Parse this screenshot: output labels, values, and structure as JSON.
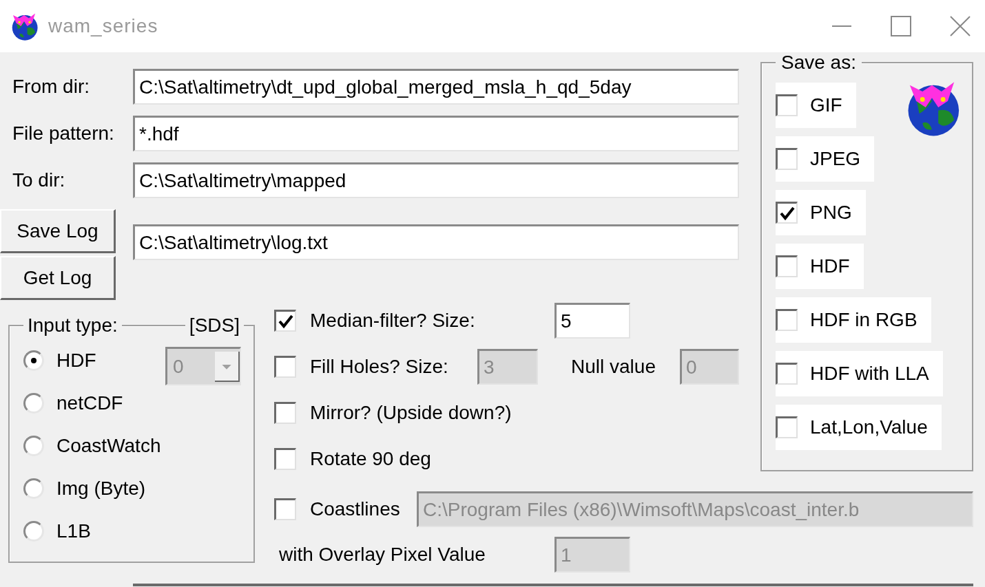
{
  "window": {
    "title": "wam_series"
  },
  "paths": [
    {
      "label": "From dir:",
      "value": "C:\\Sat\\altimetry\\dt_upd_global_merged_msla_h_qd_5day"
    },
    {
      "label": "File pattern:",
      "value": "*.hdf"
    },
    {
      "label": "To dir:",
      "value": "C:\\Sat\\altimetry\\mapped"
    }
  ],
  "log": {
    "buttons": [
      "Save Log",
      "Get Log"
    ],
    "value": "C:\\Sat\\altimetry\\log.txt"
  },
  "input_type": {
    "legend": "Input type:",
    "sds_label": "[SDS]",
    "sds_value": "0",
    "sds_disabled": true,
    "options": [
      {
        "label": "HDF",
        "selected": true
      },
      {
        "label": "netCDF",
        "selected": false
      },
      {
        "label": "CoastWatch",
        "selected": false
      },
      {
        "label": "Img (Byte)",
        "selected": false
      },
      {
        "label": "L1B",
        "selected": false
      }
    ]
  },
  "median": {
    "label": "Median-filter? Size:",
    "checked": true,
    "size": "5",
    "disabled": false
  },
  "fill_holes": {
    "label": "Fill Holes? Size:",
    "checked": false,
    "size": "3",
    "disabled": true
  },
  "null_value": {
    "label": "Null value",
    "value": "0",
    "disabled": true
  },
  "mirror": {
    "label": "Mirror? (Upside down?)",
    "checked": false
  },
  "rotate": {
    "label": "Rotate 90 deg",
    "checked": false
  },
  "coastlines": {
    "label": "Coastlines",
    "checked": false,
    "path": "C:\\Program Files (x86)\\Wimsoft\\Maps\\coast_inter.b",
    "disabled": true
  },
  "overlay": {
    "label": "with Overlay Pixel Value",
    "value": "1",
    "disabled": true
  },
  "save_as": {
    "legend": "Save as:",
    "formats": [
      {
        "label": "GIF",
        "checked": false
      },
      {
        "label": "JPEG",
        "checked": false
      },
      {
        "label": "PNG",
        "checked": true
      },
      {
        "label": "HDF",
        "checked": false
      },
      {
        "label": "HDF in RGB",
        "checked": false
      },
      {
        "label": "HDF with LLA",
        "checked": false
      },
      {
        "label": "Lat,Lon,Value",
        "checked": false
      }
    ]
  }
}
